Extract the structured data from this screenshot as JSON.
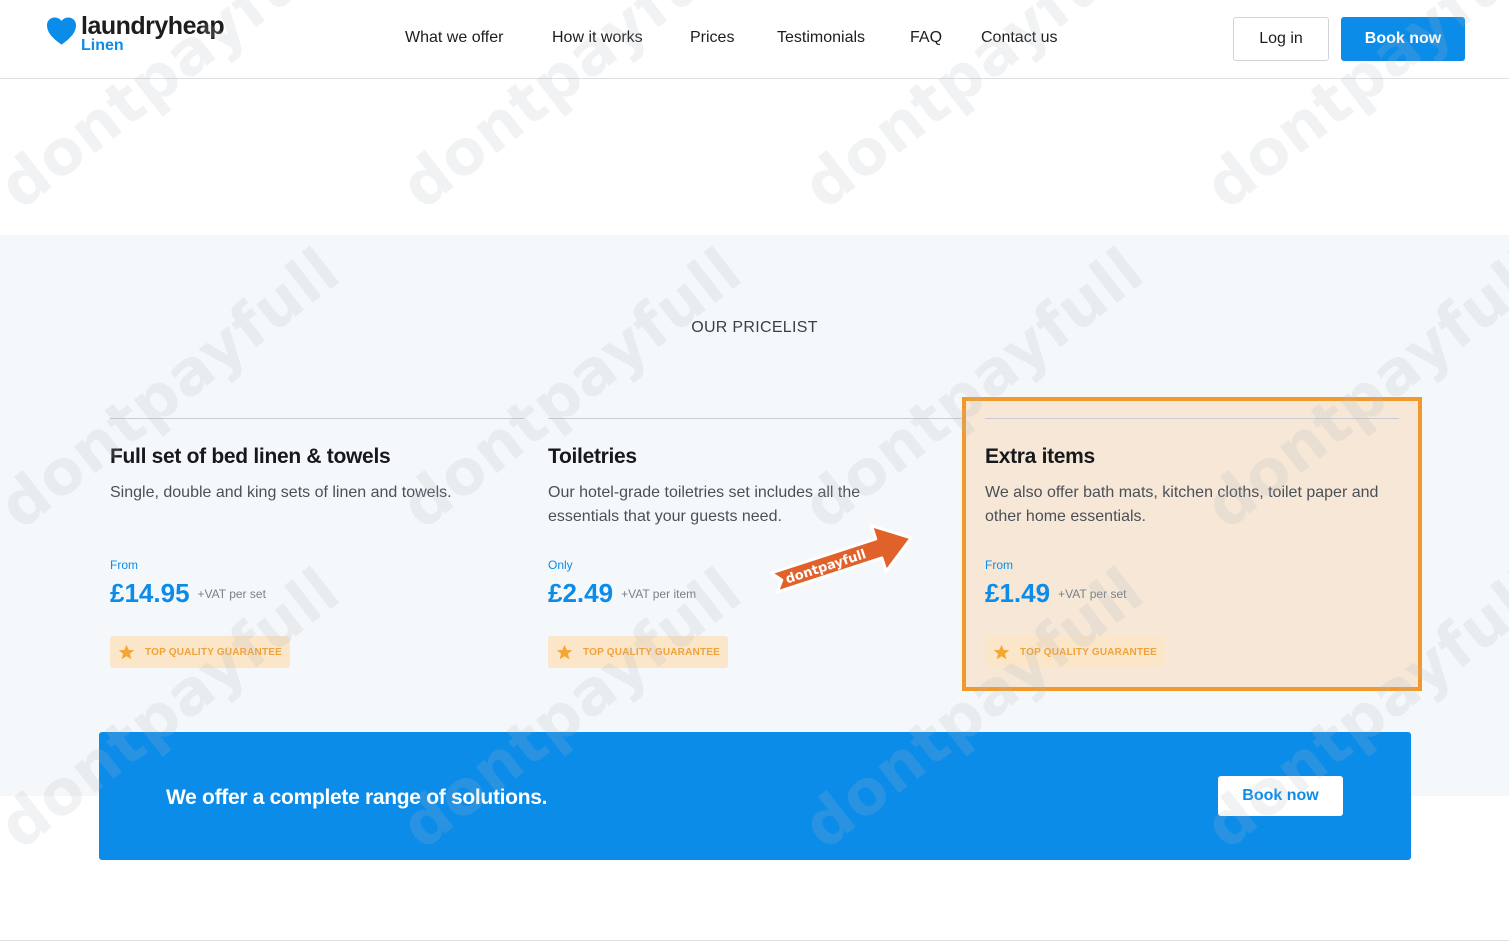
{
  "header": {
    "logo_name": "laundryheap",
    "logo_sub": "Linen",
    "nav": [
      "What we offer",
      "How it works",
      "Prices",
      "Testimonials",
      "FAQ",
      "Contact us"
    ],
    "login_label": "Log in",
    "book_label": "Book now"
  },
  "pricelist": {
    "title": "OUR PRICELIST",
    "cards": [
      {
        "title": "Full set of bed linen & towels",
        "description": "Single, double and king sets of linen and towels.",
        "price_label": "From",
        "price": "£14.95",
        "vat": "+VAT per set",
        "badge": "TOP QUALITY GUARANTEE"
      },
      {
        "title": "Toiletries",
        "description": "Our hotel-grade toiletries set includes all the essentials that your guests need.",
        "price_label": "Only",
        "price": "£2.49",
        "vat": "+VAT per item",
        "badge": "TOP QUALITY GUARANTEE"
      },
      {
        "title": "Extra items",
        "description": "We also offer bath mats, kitchen cloths, toilet paper and other home essentials.",
        "price_label": "From",
        "price": "£1.49",
        "vat": "+VAT per set",
        "badge": "TOP QUALITY GUARANTEE"
      }
    ]
  },
  "banner": {
    "text": "We offer a complete range of solutions.",
    "button": "Book now"
  },
  "watermark": "dontpayfull",
  "sticker": "dontpayfull",
  "colors": {
    "brand_blue": "#0c8ce9",
    "badge_bg": "#fbe6c9",
    "badge_text": "#f2a23a",
    "highlight_border": "#f2992e",
    "sticker": "#e0622a"
  },
  "icons": [
    "heart-logo-icon",
    "star-icon"
  ]
}
